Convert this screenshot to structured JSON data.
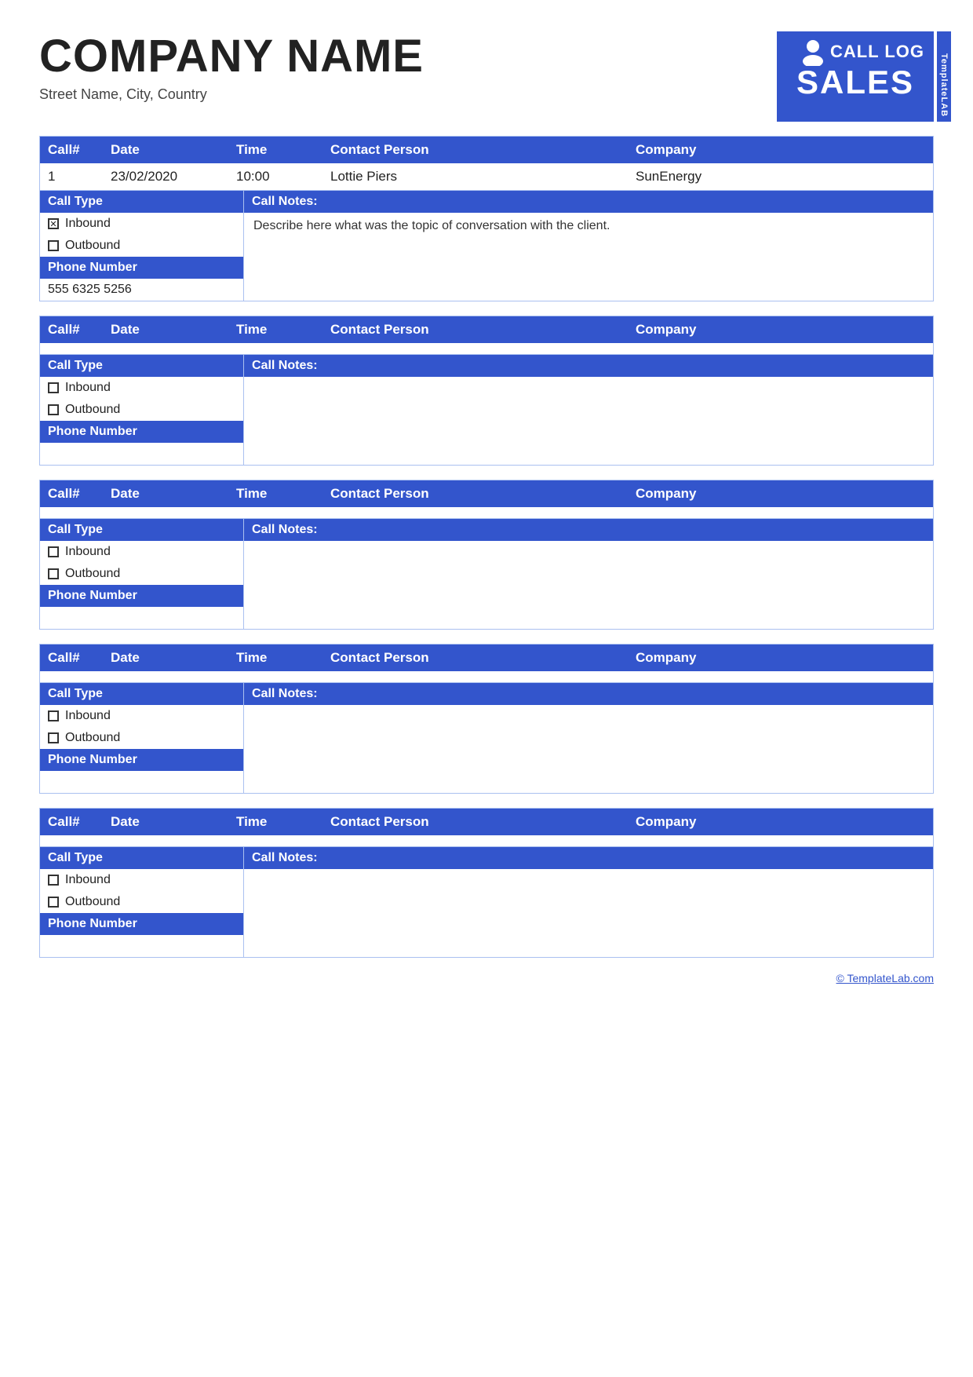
{
  "company": {
    "name": "COMPANY NAME",
    "address": "Street Name, City, Country"
  },
  "logo": {
    "call_log": "CALL LOG",
    "sales": "SALES",
    "sidebar": "TemplateLAB"
  },
  "columns": {
    "call": "Call#",
    "date": "Date",
    "time": "Time",
    "contact": "Contact Person",
    "company": "Company"
  },
  "labels": {
    "call_type": "Call Type",
    "phone_number": "Phone Number",
    "call_notes": "Call Notes:",
    "inbound": "Inbound",
    "outbound": "Outbound"
  },
  "entries": [
    {
      "call_num": "1",
      "date": "23/02/2020",
      "time": "10:00",
      "contact": "Lottie Piers",
      "company": "SunEnergy",
      "inbound_checked": true,
      "outbound_checked": false,
      "phone": "555 6325 5256",
      "notes": "Describe here what was the topic of conversation with the client."
    },
    {
      "call_num": "",
      "date": "",
      "time": "",
      "contact": "",
      "company": "",
      "inbound_checked": false,
      "outbound_checked": false,
      "phone": "",
      "notes": ""
    },
    {
      "call_num": "",
      "date": "",
      "time": "",
      "contact": "",
      "company": "",
      "inbound_checked": false,
      "outbound_checked": false,
      "phone": "",
      "notes": ""
    },
    {
      "call_num": "",
      "date": "",
      "time": "",
      "contact": "",
      "company": "",
      "inbound_checked": false,
      "outbound_checked": false,
      "phone": "",
      "notes": ""
    },
    {
      "call_num": "",
      "date": "",
      "time": "",
      "contact": "",
      "company": "",
      "inbound_checked": false,
      "outbound_checked": false,
      "phone": "",
      "notes": ""
    }
  ],
  "footer": {
    "link_text": "© TemplateLab.com",
    "link_url": "#"
  }
}
